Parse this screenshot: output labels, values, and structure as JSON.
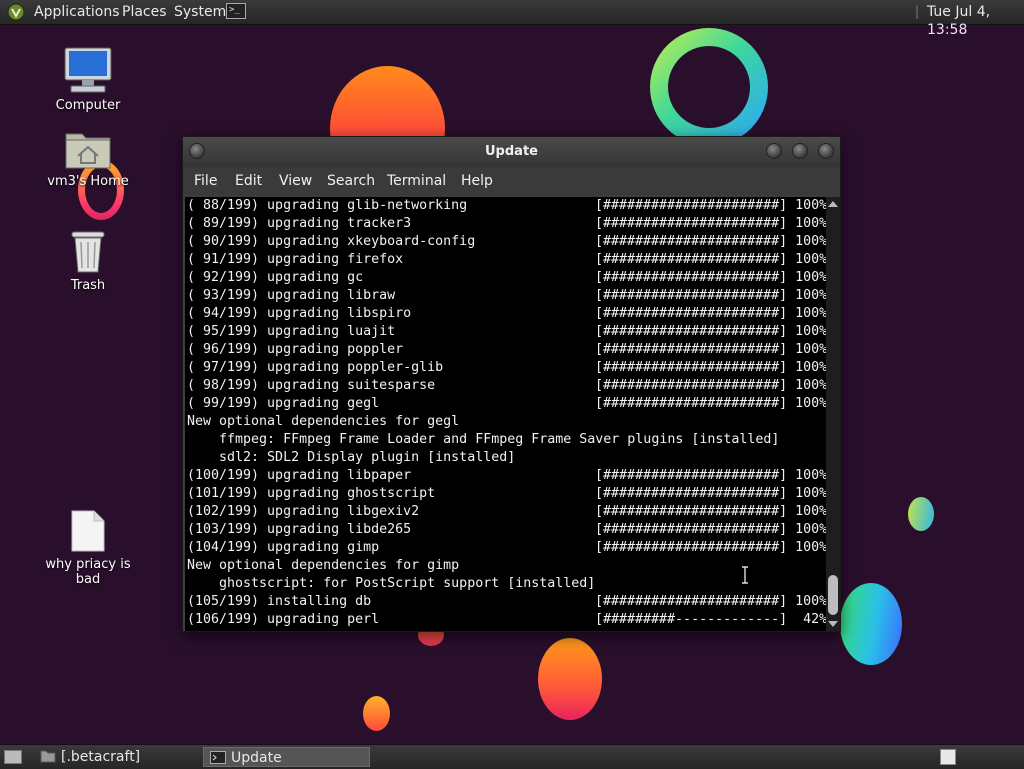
{
  "top_panel": {
    "menus": [
      "Applications",
      "Places",
      "System"
    ],
    "clock": "Tue Jul  4, 13:58"
  },
  "desktop": {
    "icons": [
      {
        "label": "Computer",
        "icon": "computer-icon"
      },
      {
        "label": "vm3's Home",
        "icon": "home-folder-icon"
      },
      {
        "label": "Trash",
        "icon": "trash-icon"
      },
      {
        "label": "why priacy is bad",
        "icon": "document-icon"
      }
    ]
  },
  "window": {
    "title": "Update",
    "menu": [
      "File",
      "Edit",
      "View",
      "Search",
      "Terminal",
      "Help"
    ],
    "lines": [
      [
        "( 88/199) upgrading glib-networking",
        "[######################] 100%"
      ],
      [
        "( 89/199) upgrading tracker3",
        "[######################] 100%"
      ],
      [
        "( 90/199) upgrading xkeyboard-config",
        "[######################] 100%"
      ],
      [
        "( 91/199) upgrading firefox",
        "[######################] 100%"
      ],
      [
        "( 92/199) upgrading gc",
        "[######################] 100%"
      ],
      [
        "( 93/199) upgrading libraw",
        "[######################] 100%"
      ],
      [
        "( 94/199) upgrading libspiro",
        "[######################] 100%"
      ],
      [
        "( 95/199) upgrading luajit",
        "[######################] 100%"
      ],
      [
        "( 96/199) upgrading poppler",
        "[######################] 100%"
      ],
      [
        "( 97/199) upgrading poppler-glib",
        "[######################] 100%"
      ],
      [
        "( 98/199) upgrading suitesparse",
        "[######################] 100%"
      ],
      [
        "( 99/199) upgrading gegl",
        "[######################] 100%"
      ],
      [
        "New optional dependencies for gegl",
        ""
      ],
      [
        "    ffmpeg: FFmpeg Frame Loader and FFmpeg Frame Saver plugins [installed]",
        ""
      ],
      [
        "    sdl2: SDL2 Display plugin [installed]",
        ""
      ],
      [
        "(100/199) upgrading libpaper",
        "[######################] 100%"
      ],
      [
        "(101/199) upgrading ghostscript",
        "[######################] 100%"
      ],
      [
        "(102/199) upgrading libgexiv2",
        "[######################] 100%"
      ],
      [
        "(103/199) upgrading libde265",
        "[######################] 100%"
      ],
      [
        "(104/199) upgrading gimp",
        "[######################] 100%"
      ],
      [
        "New optional dependencies for gimp",
        ""
      ],
      [
        "    ghostscript: for PostScript support [installed]",
        ""
      ],
      [
        "(105/199) installing db",
        "[######################] 100%"
      ],
      [
        "(106/199) upgrading perl",
        "[#########-------------]  42%"
      ]
    ]
  },
  "taskbar": {
    "tasks": [
      {
        "label": "[.betacraft]",
        "icon": "folder-icon",
        "active": false
      },
      {
        "label": "Update",
        "icon": "terminal-icon",
        "active": true
      }
    ]
  }
}
